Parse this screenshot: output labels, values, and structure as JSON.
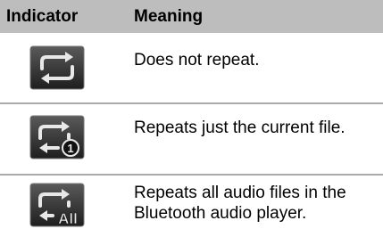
{
  "header": {
    "indicator": "Indicator",
    "meaning": "Meaning"
  },
  "rows": [
    {
      "icon": "repeat-off-icon",
      "meaning": "Does not repeat."
    },
    {
      "icon": "repeat-one-icon",
      "badge": "1",
      "meaning": "Repeats just the current file."
    },
    {
      "icon": "repeat-all-icon",
      "badge": "All",
      "meaning": "Repeats all audio files in the Bluetooth audio player."
    }
  ],
  "colors": {
    "header_bg": "#bdbdbd",
    "separator": "#aaaaaa",
    "icon_bg": "#3a3a3a",
    "icon_stroke": "#e8e8e8"
  }
}
